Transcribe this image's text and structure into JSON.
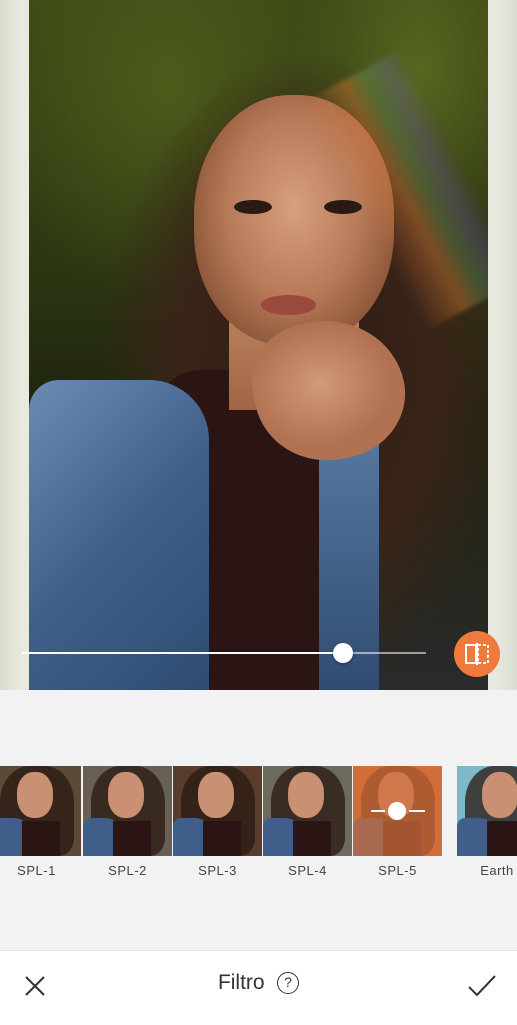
{
  "editor": {
    "intensity_fraction": 0.77,
    "compare_icon": "compare-split-icon"
  },
  "filters": {
    "items": [
      {
        "label": "SPL-1",
        "tone": "#5b4a38"
      },
      {
        "label": "SPL-2",
        "tone": "#6a5f55"
      },
      {
        "label": "SPL-3",
        "tone": "#5a3c2c"
      },
      {
        "label": "SPL-4",
        "tone": "#6b6a5c"
      },
      {
        "label": "SPL-5",
        "tone": "#c86e3c",
        "selected": true
      },
      {
        "label": "Earth",
        "tone": "#7fb7c9"
      }
    ]
  },
  "bottombar": {
    "title": "Filtro",
    "help_label": "?",
    "close_icon": "close-icon",
    "confirm_icon": "checkmark-icon"
  },
  "colors": {
    "accent": "#ee7a3c",
    "background": "#f2f2f2"
  }
}
